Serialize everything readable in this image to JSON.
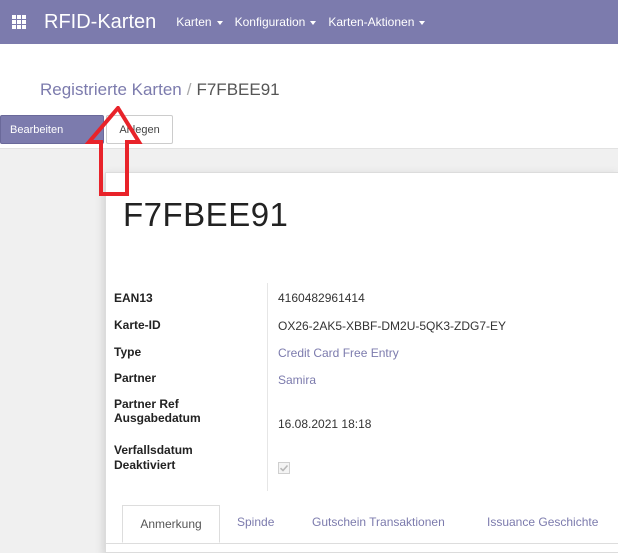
{
  "topbar": {
    "app_title": "RFID-Karten",
    "menu": [
      {
        "label": "Karten"
      },
      {
        "label": "Konfiguration"
      },
      {
        "label": "Karten-Aktionen"
      }
    ]
  },
  "breadcrumb": {
    "parent": "Registrierte Karten",
    "separator": "/",
    "current": "F7FBEE91"
  },
  "buttons": {
    "edit": "Bearbeiten",
    "create": "Anlegen"
  },
  "record": {
    "title": "F7FBEE91",
    "fields": {
      "ean13": {
        "label": "EAN13",
        "value": "4160482961414"
      },
      "karte_id": {
        "label": "Karte-ID",
        "value": "OX26-2AK5-XBBF-DM2U-5QK3-ZDG7-EY"
      },
      "type": {
        "label": "Type",
        "value": "Credit Card Free Entry"
      },
      "partner": {
        "label": "Partner",
        "value": "Samira"
      },
      "partner_ref": {
        "label": "Partner Ref",
        "value": ""
      },
      "ausgabedatum": {
        "label": "Ausgabedatum",
        "value": "16.08.2021 18:18"
      },
      "verfallsdatum": {
        "label": "Verfallsdatum",
        "value": ""
      },
      "deaktiviert": {
        "label": "Deaktiviert",
        "checked": true
      }
    }
  },
  "tabs": [
    {
      "label": "Anmerkung",
      "active": true
    },
    {
      "label": "Spinde"
    },
    {
      "label": "Gutschein Transaktionen"
    },
    {
      "label": "Issuance Geschichte"
    }
  ],
  "colors": {
    "brand": "#7c7bad",
    "annotation_arrow": "#e8232a"
  }
}
